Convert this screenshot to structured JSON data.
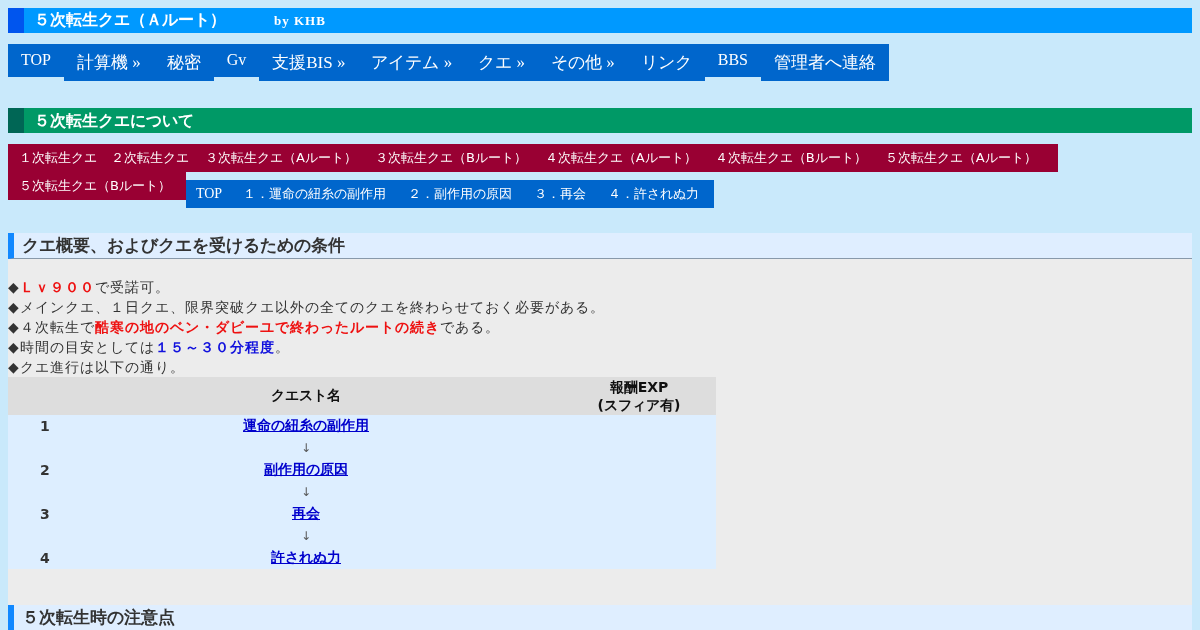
{
  "header": {
    "title": "５次転生クエ（Ａルート）",
    "byline": "by KHB"
  },
  "main_nav": [
    {
      "label": "TOP",
      "kind": "plain"
    },
    {
      "label": "計算機 »",
      "kind": "menu"
    },
    {
      "label": "秘密",
      "kind": "menu"
    },
    {
      "label": "Gv",
      "kind": "plain"
    },
    {
      "label": "支援BIS »",
      "kind": "menu"
    },
    {
      "label": "アイテム »",
      "kind": "menu"
    },
    {
      "label": "クエ »",
      "kind": "menu"
    },
    {
      "label": "その他 »",
      "kind": "menu"
    },
    {
      "label": "リンク",
      "kind": "menu"
    },
    {
      "label": "BBS",
      "kind": "plain"
    },
    {
      "label": "管理者へ連絡",
      "kind": "menu"
    }
  ],
  "section_title": "５次転生クエについて",
  "quest_nav": [
    "１次転生クエ",
    "２次転生クエ",
    "３次転生クエ（Aルート）",
    "３次転生クエ（Bルート）",
    "４次転生クエ（Aルート）",
    "４次転生クエ（Bルート）",
    "５次転生クエ（Aルート）",
    "５次転生クエ（Bルート）"
  ],
  "page_nav": [
    "TOP",
    "１．運命の紐糸の副作用",
    "２．副作用の原因",
    "３．再会",
    "４．許されぬ力"
  ],
  "overview": {
    "heading": "クエ概要、およびクエを受けるための条件",
    "lines": [
      [
        {
          "text": "◆",
          "kind": "plain"
        },
        {
          "text": "Ｌｖ９００",
          "kind": "red"
        },
        {
          "text": "で受諾可。",
          "kind": "plain"
        }
      ],
      [
        {
          "text": "◆メインクエ、１日クエ、限界突破クエ以外の全てのクエを終わらせておく必要がある。",
          "kind": "plain"
        }
      ],
      [
        {
          "text": "◆４次転生で",
          "kind": "plain"
        },
        {
          "text": "酷寒の地のベン・ダビーユで終わったルートの続き",
          "kind": "red"
        },
        {
          "text": "である。",
          "kind": "plain"
        }
      ],
      [
        {
          "text": "◆時間の目安としては",
          "kind": "plain"
        },
        {
          "text": "１５～３０分程度",
          "kind": "blue"
        },
        {
          "text": "。",
          "kind": "plain"
        }
      ],
      [
        {
          "text": "◆クエ進行は以下の通り。",
          "kind": "plain"
        }
      ]
    ],
    "table": {
      "columns": [
        "クエスト名",
        "報酬EXP\n(スフィア有)"
      ],
      "rows": [
        {
          "number": "1",
          "name": "運命の紐糸の副作用"
        },
        {
          "arrow": "↓"
        },
        {
          "number": "2",
          "name": "副作用の原因"
        },
        {
          "arrow": "↓"
        },
        {
          "number": "3",
          "name": "再会"
        },
        {
          "arrow": "↓"
        },
        {
          "number": "4",
          "name": "許されぬ力"
        }
      ]
    }
  },
  "next_heading": "５次転生時の注意点"
}
